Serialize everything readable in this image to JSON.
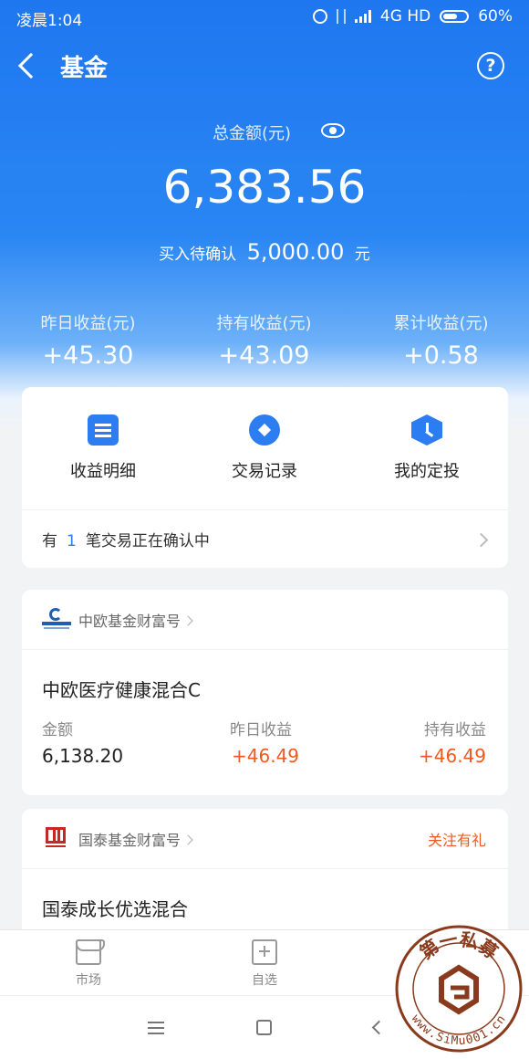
{
  "status_bar": {
    "time": "凌晨1:04",
    "network": "4G HD",
    "battery": "60%",
    "battery_level": 0.6
  },
  "header": {
    "title": "基金"
  },
  "summary": {
    "total_label": "总金额(元)",
    "total_value": "6,383.56",
    "pending_prefix": "买入待确认",
    "pending_amount": "5,000.00",
    "pending_unit": "元"
  },
  "stats": [
    {
      "label": "昨日收益(元)",
      "value": "+45.30"
    },
    {
      "label": "持有收益(元)",
      "value": "+43.09"
    },
    {
      "label": "累计收益(元)",
      "value": "+0.58"
    }
  ],
  "quick_actions": [
    {
      "label": "收益明细",
      "icon": "document-icon"
    },
    {
      "label": "交易记录",
      "icon": "record-icon"
    },
    {
      "label": "我的定投",
      "icon": "clock-icon"
    }
  ],
  "confirm_notice": {
    "prefix": "有",
    "count": "1",
    "suffix": "笔交易正在确认中"
  },
  "funds": [
    {
      "company": "中欧基金财富号",
      "logo_text": "中欧基金",
      "name": "中欧医疗健康混合C",
      "amount_label": "金额",
      "amount": "6,138.20",
      "yesterday_label": "昨日收益",
      "yesterday": "+46.49",
      "holding_label": "持有收益",
      "holding": "+46.49"
    },
    {
      "company": "国泰基金财富号",
      "follow_label": "关注有礼",
      "name": "国泰成长优选混合"
    }
  ],
  "tabbar": [
    {
      "label": "市场",
      "icon": "market-icon"
    },
    {
      "label": "自选",
      "icon": "add-favorite-icon"
    }
  ],
  "watermark": {
    "text": "www.SiMu001.cn",
    "title": "第一私募"
  },
  "colors": {
    "primary": "#1f77f0",
    "positive": "#f05a1e",
    "accent": "#2c7df2"
  }
}
